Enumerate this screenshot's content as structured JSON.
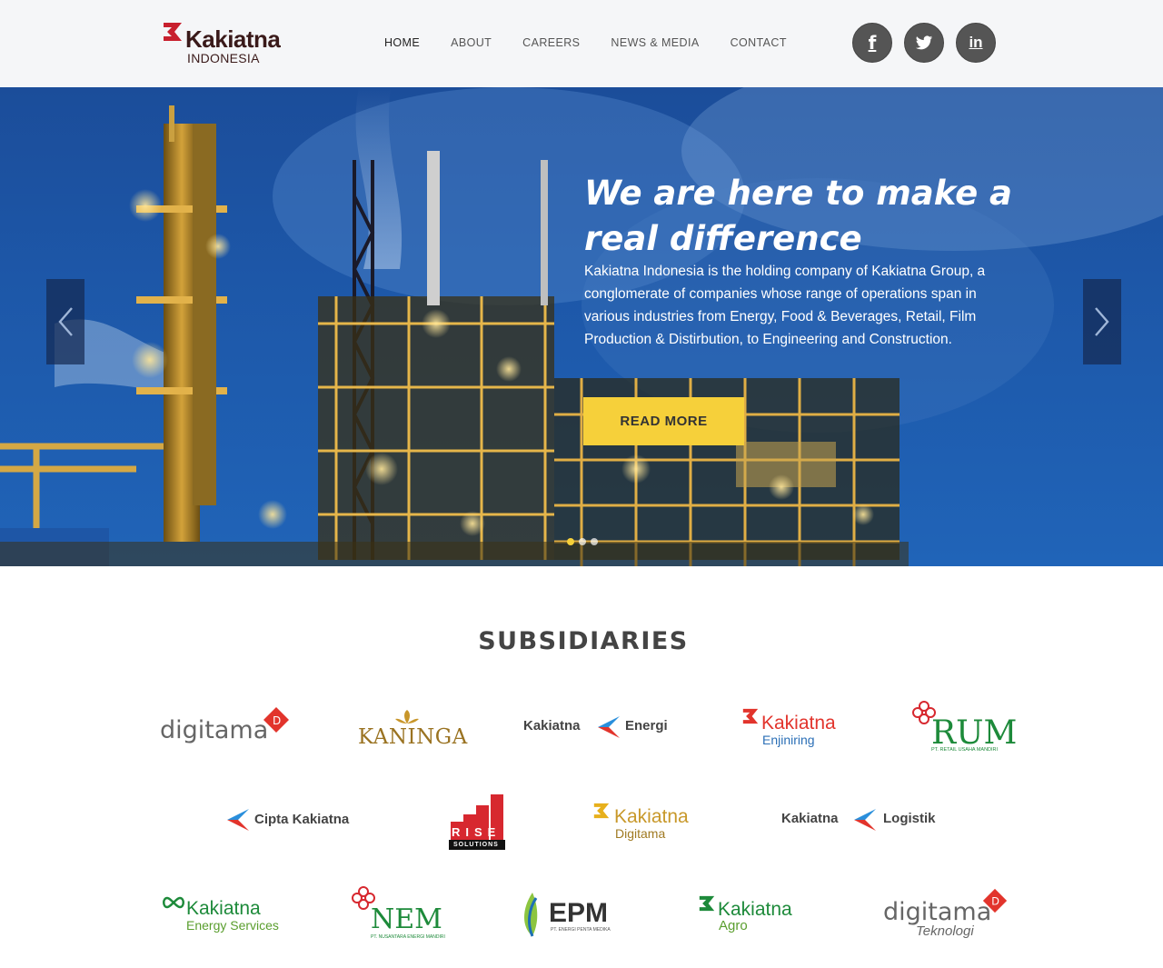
{
  "logo": {
    "word": "Kakiatna",
    "sub": "INDONESIA"
  },
  "nav": [
    {
      "label": "HOME",
      "active": true
    },
    {
      "label": "ABOUT"
    },
    {
      "label": "CAREERS"
    },
    {
      "label": "NEWS & MEDIA"
    },
    {
      "label": "CONTACT"
    }
  ],
  "social": [
    {
      "icon": "facebook-icon",
      "glyph": "f"
    },
    {
      "icon": "twitter-icon",
      "glyph": "t"
    },
    {
      "icon": "linkedin-icon",
      "glyph": "in"
    }
  ],
  "hero": {
    "title": "We are here to make a real difference",
    "text": "Kakiatna Indonesia is the holding company of Kakiatna Group, a conglomerate of companies whose range of operations span in various industries from Energy, Food & Beverages, Retail, Film Production & Distirbution, to Engineering and Construction.",
    "button": "READ MORE",
    "slides": 3,
    "active_slide": 1
  },
  "subsidiaries": {
    "title": "SUBSIDIARIES",
    "brands": {
      "digitama": "digitama",
      "kaninga": "KANINGA",
      "ke_left": "Kakiatna",
      "ke_right": "Energi",
      "kej_main": "Kakiatna",
      "kej_sub": "Enjiniring",
      "rum_main": "RUM",
      "rum_sub": "PT. RETAIL USAHA MANDIRI",
      "cipta": "Cipta Kakiatna",
      "rise": "RISE",
      "rise_sub": "SOLUTIONS",
      "kd_main": "Kakiatna",
      "kd_sub": "Digitama",
      "kl_left": "Kakiatna",
      "kl_right": "Logistik",
      "kes_main": "Kakiatna",
      "kes_sub": "Energy Services",
      "nem_main": "NEM",
      "nem_sub": "PT. NUSANTARA ENERGI MANDIRI",
      "epm_main": "EPM",
      "epm_sub": "PT. ENERGI PENTA MEDIKA",
      "ka_main": "Kakiatna",
      "ka_sub": "Agro",
      "dt_main": "digitama",
      "dt_sub": "Teknologi"
    }
  },
  "colors": {
    "accent": "#f6d03a",
    "brand_red": "#c8202e",
    "brand_green": "#1d8a3a",
    "nav_text": "#555555"
  }
}
